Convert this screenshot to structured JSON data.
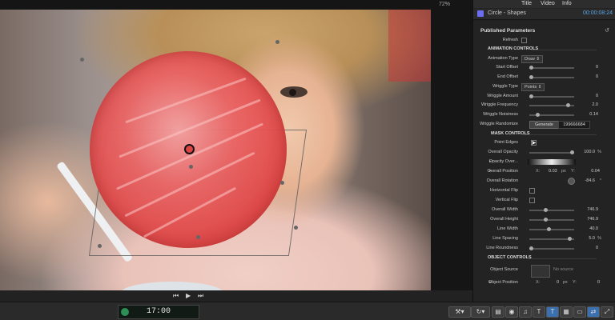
{
  "viewer": {
    "zoom": "72%"
  },
  "transport": {
    "prev_icon": "skip-back-icon",
    "play_icon": "play-icon",
    "next_icon": "skip-forward-icon"
  },
  "timecode": {
    "value": "17:00"
  },
  "inspector": {
    "tabs": [
      "Title",
      "Video",
      "Info"
    ],
    "title": "Circle - Shapes",
    "timecode": "00:00:08:24",
    "section_title": "Published Parameters",
    "rows": {
      "refresh": "Refresh",
      "animation_controls": "ANIMATION CONTROLS",
      "animation_type": "Animation Type",
      "animation_type_value": "Draw",
      "start_offset": "Start Offset",
      "start_offset_value": "0",
      "end_offset": "End Offset",
      "end_offset_value": "0",
      "wriggle_type": "Wriggle Type",
      "wriggle_type_value": "Points",
      "wriggle_amount": "Wriggle Amount",
      "wriggle_amount_value": "0",
      "wriggle_frequency": "Wriggle Frequency",
      "wriggle_frequency_value": "2.0",
      "wriggle_noisiness": "Wriggle Noisiness",
      "wriggle_noisiness_value": "0.14",
      "wriggle_randomize": "Wriggle Randomize",
      "generate_label": "Generate",
      "wriggle_randomize_value": "199666684",
      "mask_controls": "MASK CONTROLS",
      "point_edges": "Point Edges",
      "overall_opacity": "Overall Opacity",
      "overall_opacity_value": "100.0",
      "overall_opacity_unit": "%",
      "opacity_over": "Opacity Over...",
      "overall_position": "Overall Position",
      "x_label": "X:",
      "overall_position_x": "0.03",
      "px_unit": "px",
      "y_label": "Y:",
      "overall_position_y": "0.04",
      "overall_rotation": "Overall Rotation",
      "overall_rotation_value": "-84.6",
      "overall_rotation_unit": "°",
      "horizontal_flip": "Horizontal Flip",
      "vertical_flip": "Vertical Flip",
      "overall_width": "Overall Width",
      "overall_width_value": "746.9",
      "overall_height": "Overall Height",
      "overall_height_value": "746.9",
      "line_width": "Line Width",
      "line_width_value": "40.0",
      "line_spacing": "Line Spacing",
      "line_spacing_value": "5.0",
      "line_spacing_unit": "%",
      "line_roundness": "Line Roundness",
      "line_roundness_value": "0",
      "object_controls": "OBJECT CONTROLS",
      "object_source": "Object Source",
      "no_source": "No source",
      "object_position": "Object Position",
      "object_position_x": "0",
      "object_position_y": "0"
    }
  },
  "colors": {
    "accent": "#5aa6e6",
    "mask_red": "#de4545",
    "timecode_green": "#2c8f55"
  }
}
